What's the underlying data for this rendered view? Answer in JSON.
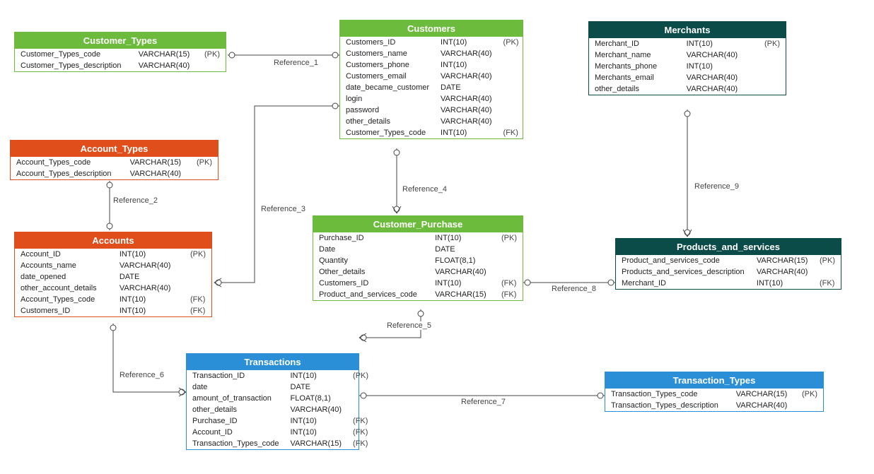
{
  "entities": {
    "customer_types": {
      "title": "Customer_Types",
      "rows": [
        {
          "name": "Customer_Types_code",
          "type": "VARCHAR(15)",
          "key": "(PK)"
        },
        {
          "name": "Customer_Types_description",
          "type": "VARCHAR(40)",
          "key": ""
        }
      ]
    },
    "account_types": {
      "title": "Account_Types",
      "rows": [
        {
          "name": "Account_Types_code",
          "type": "VARCHAR(15)",
          "key": "(PK)"
        },
        {
          "name": "Account_Types_description",
          "type": "VARCHAR(40)",
          "key": ""
        }
      ]
    },
    "accounts": {
      "title": "Accounts",
      "rows": [
        {
          "name": "Account_ID",
          "type": "INT(10)",
          "key": "(PK)"
        },
        {
          "name": "Accounts_name",
          "type": "VARCHAR(40)",
          "key": ""
        },
        {
          "name": "date_opened",
          "type": "DATE",
          "key": ""
        },
        {
          "name": "other_account_details",
          "type": "VARCHAR(40)",
          "key": ""
        },
        {
          "name": "Account_Types_code",
          "type": "INT(10)",
          "key": "(FK)"
        },
        {
          "name": "Customers_ID",
          "type": "INT(10)",
          "key": "(FK)"
        }
      ]
    },
    "customers": {
      "title": "Customers",
      "rows": [
        {
          "name": "Customers_ID",
          "type": "INT(10)",
          "key": "(PK)"
        },
        {
          "name": "Customers_name",
          "type": "VARCHAR(40)",
          "key": ""
        },
        {
          "name": "Customers_phone",
          "type": "INT(10)",
          "key": ""
        },
        {
          "name": "Customers_email",
          "type": "VARCHAR(40)",
          "key": ""
        },
        {
          "name": "date_became_customer",
          "type": "DATE",
          "key": ""
        },
        {
          "name": "login",
          "type": "VARCHAR(40)",
          "key": ""
        },
        {
          "name": "password",
          "type": "VARCHAR(40)",
          "key": ""
        },
        {
          "name": "other_details",
          "type": "VARCHAR(40)",
          "key": ""
        },
        {
          "name": "Customer_Types_code",
          "type": "INT(10)",
          "key": "(FK)"
        }
      ]
    },
    "customer_purchase": {
      "title": "Customer_Purchase",
      "rows": [
        {
          "name": "Purchase_ID",
          "type": "INT(10)",
          "key": "(PK)"
        },
        {
          "name": "Date",
          "type": "DATE",
          "key": ""
        },
        {
          "name": "Quantity",
          "type": "FLOAT(8,1)",
          "key": ""
        },
        {
          "name": "Other_details",
          "type": "VARCHAR(40)",
          "key": ""
        },
        {
          "name": "Customers_ID",
          "type": "INT(10)",
          "key": "(FK)"
        },
        {
          "name": "Product_and_services_code",
          "type": "VARCHAR(15)",
          "key": "(FK)"
        }
      ]
    },
    "merchants": {
      "title": "Merchants",
      "rows": [
        {
          "name": "Merchant_ID",
          "type": "INT(10)",
          "key": "(PK)"
        },
        {
          "name": "Merchant_name",
          "type": "VARCHAR(40)",
          "key": ""
        },
        {
          "name": "Merchants_phone",
          "type": "INT(10)",
          "key": ""
        },
        {
          "name": "Merchants_email",
          "type": "VARCHAR(40)",
          "key": ""
        },
        {
          "name": "other_details",
          "type": "VARCHAR(40)",
          "key": ""
        }
      ]
    },
    "products_and_services": {
      "title": "Products_and_services",
      "rows": [
        {
          "name": "Product_and_services_code",
          "type": "VARCHAR(15)",
          "key": "(PK)"
        },
        {
          "name": "Products_and_services_description",
          "type": "VARCHAR(40)",
          "key": ""
        },
        {
          "name": "Merchant_ID",
          "type": "INT(10)",
          "key": "(FK)"
        }
      ]
    },
    "transactions": {
      "title": "Transactions",
      "rows": [
        {
          "name": "Transaction_ID",
          "type": "INT(10)",
          "key": "(PK)"
        },
        {
          "name": "date",
          "type": "DATE",
          "key": ""
        },
        {
          "name": "amount_of_transaction",
          "type": "FLOAT(8,1)",
          "key": ""
        },
        {
          "name": "other_details",
          "type": "VARCHAR(40)",
          "key": ""
        },
        {
          "name": "Purchase_ID",
          "type": "INT(10)",
          "key": "(FK)"
        },
        {
          "name": "Account_ID",
          "type": "INT(10)",
          "key": "(FK)"
        },
        {
          "name": "Transaction_Types_code",
          "type": "VARCHAR(15)",
          "key": "(FK)"
        }
      ]
    },
    "transaction_types": {
      "title": "Transaction_Types",
      "rows": [
        {
          "name": "Transaction_Types_code",
          "type": "VARCHAR(15)",
          "key": "(PK)"
        },
        {
          "name": "Transaction_Types_description",
          "type": "VARCHAR(40)",
          "key": ""
        }
      ]
    }
  },
  "references": {
    "r1": "Reference_1",
    "r2": "Reference_2",
    "r3": "Reference_3",
    "r4": "Reference_4",
    "r5": "Reference_5",
    "r6": "Reference_6",
    "r7": "Reference_7",
    "r8": "Reference_8",
    "r9": "Reference_9"
  }
}
